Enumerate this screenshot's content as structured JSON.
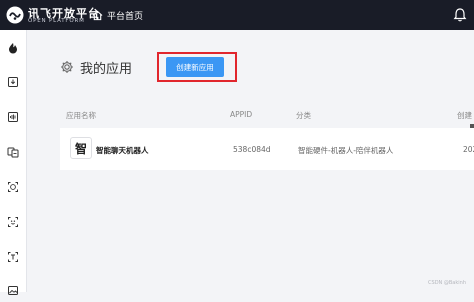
{
  "brand": {
    "name_cn": "讯飞开放平台",
    "name_en": "OPEN PLATFORM"
  },
  "topbar": {
    "home_label": "平台首页",
    "home_icon": "home-icon",
    "bell_icon": "bell-icon"
  },
  "sidebar": {
    "items": [
      {
        "icon": "spark-icon"
      },
      {
        "icon": "download-icon"
      },
      {
        "icon": "audio-wave-icon"
      },
      {
        "icon": "translate-icon"
      },
      {
        "icon": "face-icon"
      },
      {
        "icon": "scan-face-icon"
      },
      {
        "icon": "text-recognition-icon"
      },
      {
        "icon": "image-icon"
      }
    ]
  },
  "main": {
    "title": "我的应用",
    "title_icon": "gear-icon",
    "create_button": "创建新应用",
    "table": {
      "headers": [
        "应用名称",
        "APPID",
        "分类",
        "创建"
      ],
      "rows": [
        {
          "avatar": "智",
          "name": "智能聊天机器人",
          "appid": "538c084d",
          "category": "智能硬件-机器人-陪伴机器人",
          "created": "202"
        }
      ]
    }
  },
  "footer": {
    "watermark": "CSDN @Bakinh"
  },
  "colors": {
    "topbar": "#191c27",
    "accent": "#3b97f4",
    "highlight": "#e1262d"
  }
}
